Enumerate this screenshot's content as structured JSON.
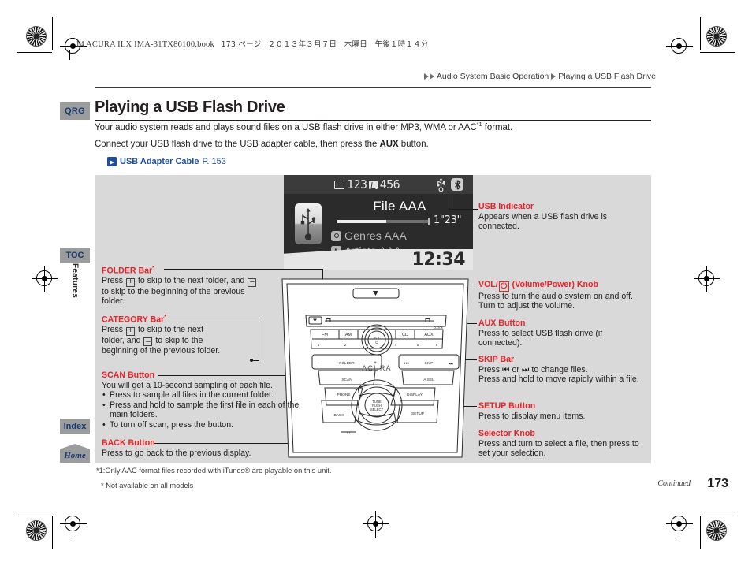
{
  "print_header": {
    "file_line": "14 ACURA ILX IMA-31TX86100.book",
    "page_line": "173 ページ",
    "date_line": "２０１３年３月７日　木曜日　午後１時１４分"
  },
  "breadcrumb": {
    "parent": "Audio System Basic Operation",
    "current": "Playing a USB Flash Drive"
  },
  "sidebar": {
    "qrg": "QRG",
    "toc": "TOC",
    "features": "Features",
    "index": "Index",
    "home": "Home"
  },
  "title": "Playing a USB Flash Drive",
  "intro": {
    "line1_pre": "Your audio system reads and plays sound files on a USB flash drive in either MP3, WMA or AAC",
    "line1_sup": "*1",
    "line1_post": " format.",
    "line2_pre": "Connect your USB flash drive to the USB adapter cable, then press the ",
    "line2_bold": "AUX",
    "line2_post": " button."
  },
  "jump_link": {
    "icon": "jump-arrow-icon",
    "label": "USB Adapter Cable",
    "page": "P. 153"
  },
  "screen": {
    "folder_icon": "folder-icon",
    "folder_number": "123",
    "track_icon": "music-note-icon",
    "track_number": "456",
    "usb_icon": "usb-icon",
    "bluetooth_icon": "bluetooth-icon",
    "usb_drive_icon": "usb-flash-drive-icon",
    "file_name": "File AAA",
    "elapsed_time": "1\"23\"",
    "genre_icon": "genre-disc-icon",
    "genre_label": "Genres AAA",
    "artist_icon": "artist-icon",
    "artist_label": "Artists AAA",
    "clock": "12:34",
    "progress_percent": 54
  },
  "unit": {
    "brand": "ACURA",
    "hazard": "hazard-icon",
    "eject": "eject-icon",
    "sources": [
      "FM",
      "AM",
      "CD",
      "AUX"
    ],
    "presets": [
      "1",
      "2",
      "3",
      "4",
      "5",
      "6"
    ],
    "vol_label": "VOL",
    "folder_label": "FOLDER",
    "scan_label": "SCAN",
    "skip_label": "SKIP",
    "asel_label": "A.SEL",
    "phone_label": "PHONE",
    "display_label": "DISPLAY",
    "back_label": "BACK",
    "setup_label": "SETUP",
    "selector_label": "TUNE\nPUSH\nSELECT",
    "clock_label": "CLOCK",
    "nav_label": "‹ ›"
  },
  "annotations": {
    "folder_bar": {
      "heading": "FOLDER Bar",
      "heading_sup": "*",
      "body_a": "Press ",
      "key_plus": "+",
      "body_b": " to skip to the next folder, and ",
      "key_minus": "–",
      "body_c": " to skip to the beginning of the previous folder."
    },
    "category_bar": {
      "heading": "CATEGORY Bar",
      "heading_sup": "*",
      "body_a": "Press ",
      "key_plus": "+",
      "body_b": " to skip to the next folder, and ",
      "key_minus": "–",
      "body_c": " to skip to the beginning of the previous folder."
    },
    "scan_button": {
      "heading": "SCAN Button",
      "body": "You will get a 10-second sampling of each file.",
      "bullets": [
        "Press to sample all files in the current folder.",
        "Press and hold to sample the first file in each of the main folders.",
        "To turn off scan, press the button."
      ]
    },
    "back_button": {
      "heading": "BACK Button",
      "body": "Press to go back to the previous display."
    },
    "usb_indicator": {
      "heading": "USB Indicator",
      "body": "Appears when a USB flash drive is connected."
    },
    "vol_knob": {
      "heading_a": "VOL/",
      "power_icon": "power-icon",
      "heading_b": " (Volume/Power) Knob",
      "body": "Press to turn the audio system on and off. Turn to adjust the volume."
    },
    "aux_button": {
      "heading": "AUX Button",
      "body": "Press to select USB flash drive (if connected)."
    },
    "skip_bar": {
      "heading": "SKIP Bar",
      "body_a": "Press ",
      "icon_prev": "skip-previous-icon",
      "body_b": " or ",
      "icon_next": "skip-next-icon",
      "body_c": " to change files.",
      "body_d": "Press and hold to move rapidly within a file."
    },
    "setup_button": {
      "heading": "SETUP Button",
      "body": "Press to display menu items."
    },
    "selector_knob": {
      "heading": "Selector Knob",
      "body": "Press and turn to select a file, then press to set your selection."
    }
  },
  "footnotes": {
    "fn1": "*1:Only AAC format files recorded with iTunes® are playable on this unit.",
    "fn2": "* Not available on all models"
  },
  "footer": {
    "continued": "Continued",
    "page_number": "173"
  },
  "colors": {
    "accent_red": "#e8232a",
    "link_blue": "#1f4ea1",
    "tab_grey": "#9a9c9e",
    "panel_grey": "#d9d9d9"
  }
}
